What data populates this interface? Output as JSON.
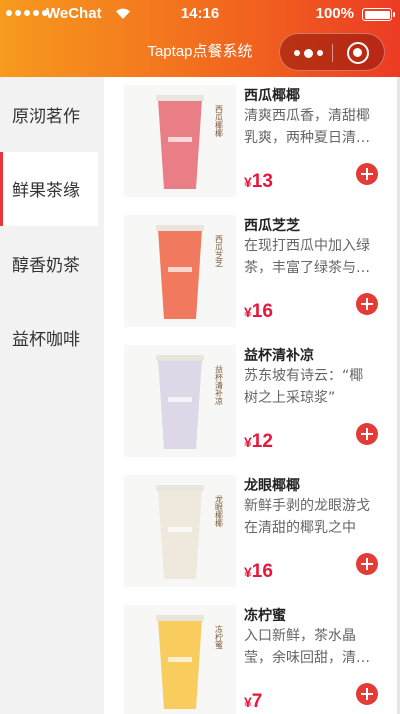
{
  "status_bar": {
    "carrier": "WeChat",
    "time": "14:16",
    "battery": "100%"
  },
  "nav": {
    "title": "Taptap点餐系统"
  },
  "sidebar": {
    "items": [
      {
        "label": "原沏茗作",
        "active": false
      },
      {
        "label": "鲜果茶缘",
        "active": true
      },
      {
        "label": "醇香奶茶",
        "active": false
      },
      {
        "label": "益杯咖啡",
        "active": false
      }
    ]
  },
  "products": [
    {
      "name": "西瓜椰椰",
      "desc": "清爽西瓜香，清甜椰乳爽，两种夏日清凉一杯尽享",
      "currency": "¥",
      "price": "13",
      "cup_color": "#e8707a",
      "cup_label": "西瓜椰椰"
    },
    {
      "name": "西瓜芝芝",
      "desc": "在现打西瓜中加入绿茶，丰富了绿茶与西瓜的口感",
      "currency": "¥",
      "price": "16",
      "cup_color": "#ef6a4e",
      "cup_label": "西瓜芝芝"
    },
    {
      "name": "益杯清补凉",
      "desc": "苏东坡有诗云：“椰树之上采琼浆”",
      "currency": "¥",
      "price": "12",
      "cup_color": "#d9d3e6",
      "cup_label": "益杯清补凉"
    },
    {
      "name": "龙眼椰椰",
      "desc": "新鲜手剥的龙眼游戈在清甜的椰乳之中",
      "currency": "¥",
      "price": "16",
      "cup_color": "#ece6da",
      "cup_label": "龙眼椰椰"
    },
    {
      "name": "冻柠蜜",
      "desc": "入口新鲜，茶水晶莹，余味回甜，清爽解渴",
      "currency": "¥",
      "price": "7",
      "cup_color": "#f7c64d",
      "cup_label": "冻柠蜜"
    }
  ]
}
